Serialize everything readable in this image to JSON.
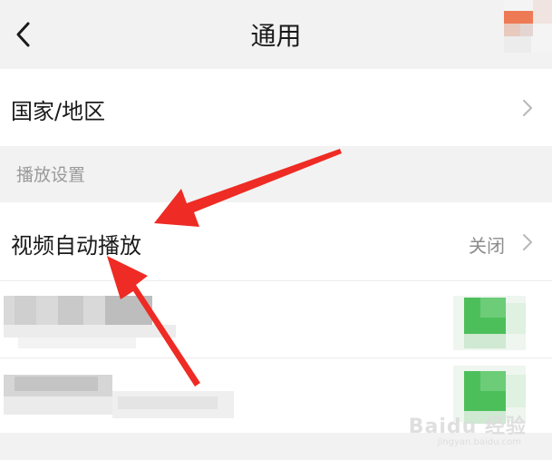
{
  "header": {
    "title": "通用",
    "back_icon": "chevron-left-icon"
  },
  "rows": {
    "region_label": "国家/地区",
    "section_title": "播放设置",
    "autoplay_label": "视频自动播放",
    "autoplay_value": "关闭"
  },
  "watermark": {
    "brand": "Baidu 经验",
    "url": "jingyan.baidu.com"
  },
  "colors": {
    "background": "#f2f2f2",
    "row_bg": "#ffffff",
    "arrow": "#ee2b24",
    "toggle_green": "#4cbf5a"
  }
}
